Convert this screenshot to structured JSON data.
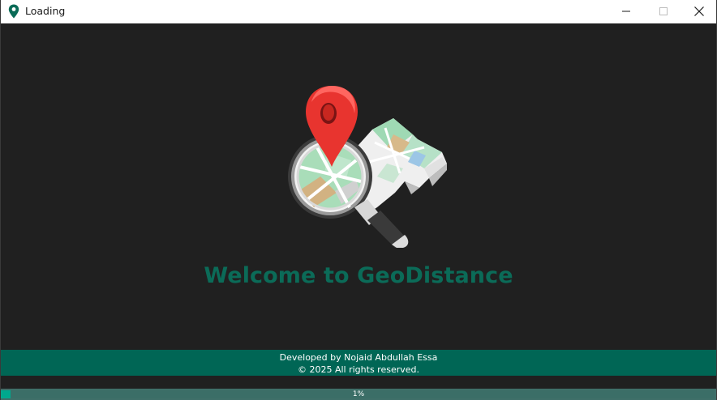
{
  "window": {
    "title": "Loading",
    "app_icon": "map-pin-icon",
    "controls": [
      "minimize-icon",
      "maximize-icon",
      "close-icon"
    ]
  },
  "main": {
    "logo_icon": "map-magnifier-icon",
    "welcome": "Welcome to GeoDistance"
  },
  "footer": {
    "line1": "Developed by Nojaid Abdullah Essa",
    "line2": "© 2025 All rights reserved."
  },
  "progress": {
    "value_percent": 1,
    "label": "1%"
  },
  "colors": {
    "accent": "#006655",
    "welcome_text": "#0b6b58",
    "background": "#202020",
    "progress_fill": "#00a88e"
  }
}
